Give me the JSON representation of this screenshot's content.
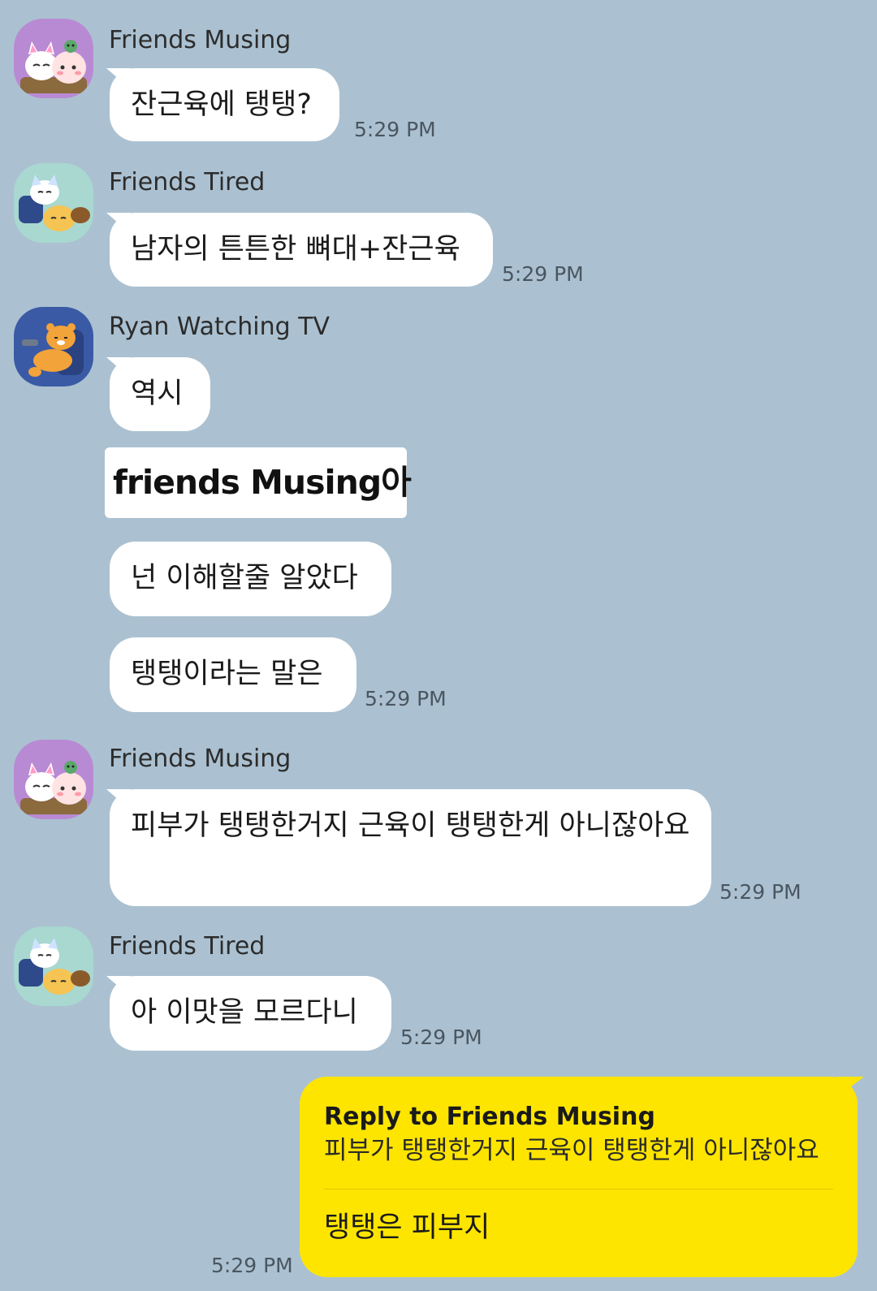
{
  "messages": [
    {
      "sender": "Friends Musing",
      "text": "잔근육에 탱탱?",
      "time": "5:29 PM"
    },
    {
      "sender": "Friends Tired",
      "text": "남자의 튼튼한 뼈대+잔근육",
      "time": "5:29 PM"
    },
    {
      "sender": "Ryan Watching TV",
      "text": "역시"
    },
    {
      "mention": "friends Musing아"
    },
    {
      "text": "넌 이해할줄 알았다"
    },
    {
      "text": "탱탱이라는 말은",
      "time": "5:29 PM"
    },
    {
      "sender": "Friends Musing",
      "text": "피부가 탱탱한거지 근육이 탱탱한게 아니잖아요",
      "time": "5:29 PM"
    },
    {
      "sender": "Friends Tired",
      "text": "아 이맛을 모르다니",
      "time": "5:29 PM"
    }
  ],
  "my_reply": {
    "title": "Reply to Friends Musing",
    "quote": "피부가 탱탱한거지 근육이 탱탱한게 아니잖아요",
    "text": "탱탱은 피부지",
    "time": "5:29 PM"
  },
  "avatars": [
    {
      "name": "musing-avatar",
      "colors": {
        "bg": "#b98ad4",
        "accent": "#ffd1dc"
      }
    },
    {
      "name": "tired-avatar",
      "colors": {
        "bg": "#a8d8d0",
        "accent": "#f6c453"
      }
    },
    {
      "name": "ryan-avatar",
      "colors": {
        "bg": "#3a5aa6",
        "accent": "#f2a33a"
      }
    }
  ],
  "colors": {
    "background": "#abc1d1",
    "bubble_incoming": "#ffffff",
    "bubble_outgoing": "#fee500"
  }
}
